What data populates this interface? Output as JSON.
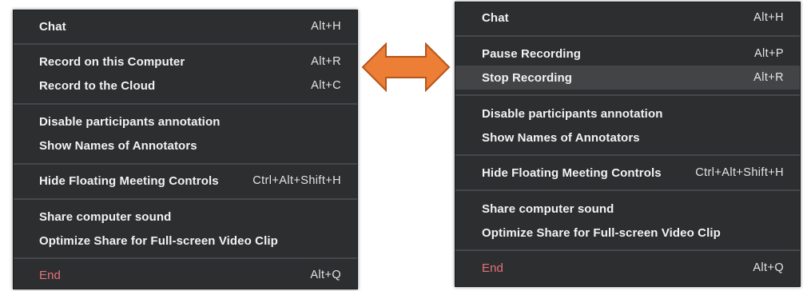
{
  "colors": {
    "menu_bg": "#2d2e30",
    "highlight_bg": "#434446",
    "separator": "#46474a",
    "text": "#f2f2f2",
    "end_text": "#e5727a",
    "arrow_fill": "#ec7e36",
    "arrow_stroke": "#b5561c"
  },
  "arrow": {
    "icon": "double-headed-arrow"
  },
  "left_menu": {
    "chat": {
      "label": "Chat",
      "shortcut": "Alt+H"
    },
    "record_local": {
      "label": "Record on this Computer",
      "shortcut": "Alt+R"
    },
    "record_cloud": {
      "label": "Record to the Cloud",
      "shortcut": "Alt+C"
    },
    "disable_annotation": {
      "label": "Disable participants annotation"
    },
    "show_annotators": {
      "label": "Show Names of Annotators"
    },
    "hide_controls": {
      "label": "Hide Floating Meeting Controls",
      "shortcut": "Ctrl+Alt+Shift+H"
    },
    "share_sound": {
      "label": "Share computer sound"
    },
    "optimize_share": {
      "label": "Optimize Share for Full-screen Video Clip"
    },
    "end": {
      "label": "End",
      "shortcut": "Alt+Q"
    }
  },
  "right_menu": {
    "chat": {
      "label": "Chat",
      "shortcut": "Alt+H"
    },
    "pause_recording": {
      "label": "Pause Recording",
      "shortcut": "Alt+P"
    },
    "stop_recording": {
      "label": "Stop Recording",
      "shortcut": "Alt+R",
      "highlighted": true
    },
    "disable_annotation": {
      "label": "Disable participants annotation"
    },
    "show_annotators": {
      "label": "Show Names of Annotators"
    },
    "hide_controls": {
      "label": "Hide Floating Meeting Controls",
      "shortcut": "Ctrl+Alt+Shift+H"
    },
    "share_sound": {
      "label": "Share computer sound"
    },
    "optimize_share": {
      "label": "Optimize Share for Full-screen Video Clip"
    },
    "end": {
      "label": "End",
      "shortcut": "Alt+Q"
    }
  }
}
